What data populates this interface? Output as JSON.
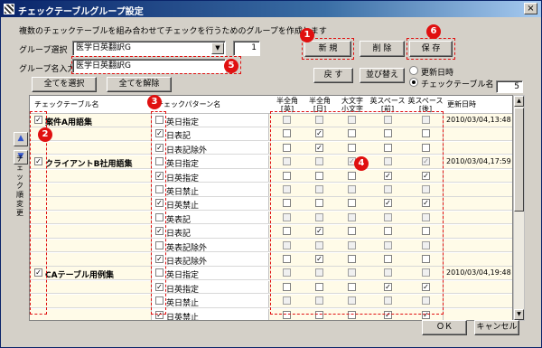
{
  "window": {
    "title": "チェックテーブルグループ設定",
    "close_glyph": "×"
  },
  "description": "複数のチェックテーブルを組み合わせてチェックを行うためのグループを作成します",
  "group_select": {
    "label": "グループ選択",
    "value": "医学日英翻訳G",
    "count": "1"
  },
  "group_name": {
    "label": "グループ名入力",
    "value": "医学日英翻訳G"
  },
  "buttons": {
    "new": "新 規",
    "delete": "削 除",
    "save": "保 存",
    "back": "戻 す",
    "sort": "並び替え",
    "select_all": "全てを選択",
    "deselect_all": "全てを解除",
    "ok": "ＯＫ",
    "cancel": "キャンセル"
  },
  "sort_options": {
    "by_date": "更新日時",
    "by_name": "チェックテーブル名",
    "selected": "by_name"
  },
  "table_count": "5",
  "side_label": "チェック順変更",
  "columns": {
    "table_name": "チェックテーブル名",
    "pattern_name": "チェックパターン名",
    "c1": [
      "半全角",
      "[英]"
    ],
    "c2": [
      "半全角",
      "[日]"
    ],
    "c3": [
      "大文字",
      "小文字"
    ],
    "c4": [
      "英スペース",
      "[前]"
    ],
    "c5": [
      "英スペース",
      "[後]"
    ],
    "updated": "更新日時"
  },
  "rows": [
    {
      "group": "案件A用語集",
      "group_checked": true,
      "date": "2010/03/04,13:48",
      "pattern": "英日指定",
      "pchecked": false,
      "checks": [
        0,
        0,
        0,
        0,
        0
      ]
    },
    {
      "group": "",
      "group_checked": false,
      "date": "",
      "pattern": "日表記",
      "pchecked": true,
      "checks": [
        0,
        1,
        0,
        0,
        0
      ]
    },
    {
      "group": "",
      "group_checked": false,
      "date": "",
      "pattern": "日表記除外",
      "pchecked": true,
      "checks": [
        0,
        1,
        0,
        0,
        0
      ]
    },
    {
      "group": "クライアントB社用語集",
      "group_checked": true,
      "date": "2010/03/04,17:59",
      "pattern": "英日指定",
      "pchecked": false,
      "checks": [
        0,
        0,
        1,
        0,
        1
      ]
    },
    {
      "group": "",
      "group_checked": false,
      "date": "",
      "pattern": "日英指定",
      "pchecked": true,
      "checks": [
        0,
        0,
        0,
        1,
        1
      ]
    },
    {
      "group": "",
      "group_checked": false,
      "date": "",
      "pattern": "英日禁止",
      "pchecked": false,
      "checks": [
        0,
        0,
        0,
        0,
        0
      ]
    },
    {
      "group": "",
      "group_checked": false,
      "date": "",
      "pattern": "日英禁止",
      "pchecked": true,
      "checks": [
        0,
        0,
        0,
        1,
        1
      ]
    },
    {
      "group": "",
      "group_checked": false,
      "date": "",
      "pattern": "英表記",
      "pchecked": false,
      "checks": [
        0,
        0,
        0,
        0,
        0
      ]
    },
    {
      "group": "",
      "group_checked": false,
      "date": "",
      "pattern": "日表記",
      "pchecked": true,
      "checks": [
        0,
        1,
        0,
        0,
        0
      ]
    },
    {
      "group": "",
      "group_checked": false,
      "date": "",
      "pattern": "英表記除外",
      "pchecked": false,
      "checks": [
        0,
        0,
        0,
        0,
        0
      ]
    },
    {
      "group": "",
      "group_checked": false,
      "date": "",
      "pattern": "日表記除外",
      "pchecked": true,
      "checks": [
        0,
        1,
        0,
        0,
        0
      ]
    },
    {
      "group": "CAテーブル用例集",
      "group_checked": true,
      "date": "2010/03/04,19:48",
      "pattern": "英日指定",
      "pchecked": false,
      "checks": [
        0,
        0,
        0,
        0,
        0
      ]
    },
    {
      "group": "",
      "group_checked": false,
      "date": "",
      "pattern": "日英指定",
      "pchecked": true,
      "checks": [
        0,
        0,
        0,
        1,
        1
      ]
    },
    {
      "group": "",
      "group_checked": false,
      "date": "",
      "pattern": "英日禁止",
      "pchecked": false,
      "checks": [
        0,
        0,
        0,
        0,
        0
      ]
    },
    {
      "group": "",
      "group_checked": false,
      "date": "",
      "pattern": "日英禁止",
      "pchecked": true,
      "checks": [
        0,
        0,
        0,
        1,
        1
      ]
    }
  ],
  "markers": [
    "1",
    "2",
    "3",
    "4",
    "5",
    "6"
  ],
  "colors": {
    "accent_red": "#e01010",
    "row_highlight": "#fffbe8",
    "title_bar": "#0a246a"
  },
  "icons": {
    "check": "✓",
    "up": "▲",
    "down": "▼"
  }
}
